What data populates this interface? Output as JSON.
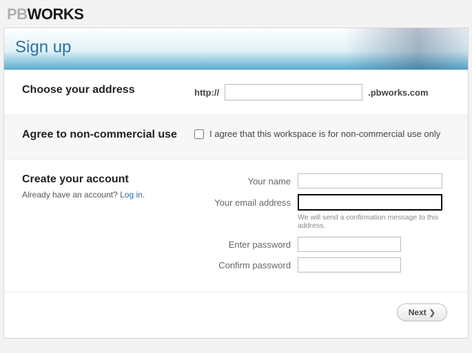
{
  "brand": {
    "part1": "PB",
    "part2": "WORKS"
  },
  "header": {
    "title": "Sign up"
  },
  "address": {
    "heading": "Choose your address",
    "prefix": "http://",
    "value": "",
    "suffix": ".pbworks.com"
  },
  "agreement": {
    "heading": "Agree to non-commercial use",
    "label": "I agree that this workspace is for non-commercial use only",
    "checked": false
  },
  "account": {
    "heading": "Create your account",
    "subtext_prefix": "Already have an account? ",
    "login_link": "Log in",
    "subtext_suffix": ".",
    "fields": {
      "name_label": "Your name",
      "name_value": "",
      "email_label": "Your email address",
      "email_value": "",
      "email_hint": "We will send a confirmation message to this address.",
      "password_label": "Enter password",
      "password_value": "",
      "confirm_label": "Confirm password",
      "confirm_value": ""
    }
  },
  "footer": {
    "next_label": "Next"
  }
}
